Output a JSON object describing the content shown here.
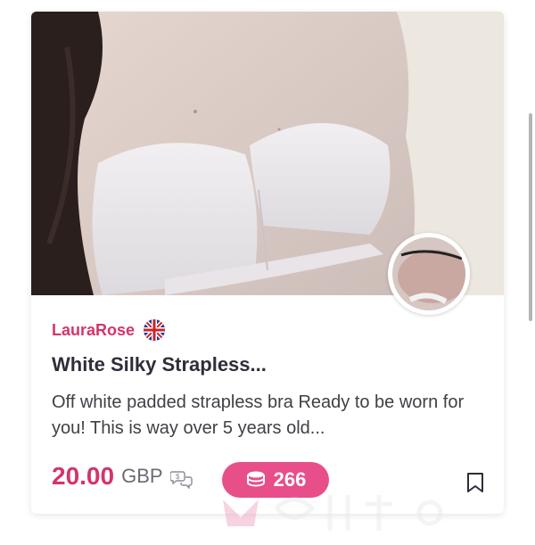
{
  "listing": {
    "seller_name": "LauraRose",
    "seller_country_icon": "uk-flag-icon",
    "title": "White Silky Strapless...",
    "description": "Off white padded strapless bra Ready to be worn for you! This is way over 5 years old...",
    "price_amount": "20.00",
    "price_currency": "GBP",
    "coins": "266",
    "icons": {
      "chat": "chat-bubbles-icon",
      "coins": "coin-stack-icon",
      "bookmark": "bookmark-icon"
    }
  },
  "colors": {
    "accent": "#d6336c",
    "badge": "#e84e8a",
    "title": "#2e2e3a",
    "text": "#3f3f46"
  }
}
